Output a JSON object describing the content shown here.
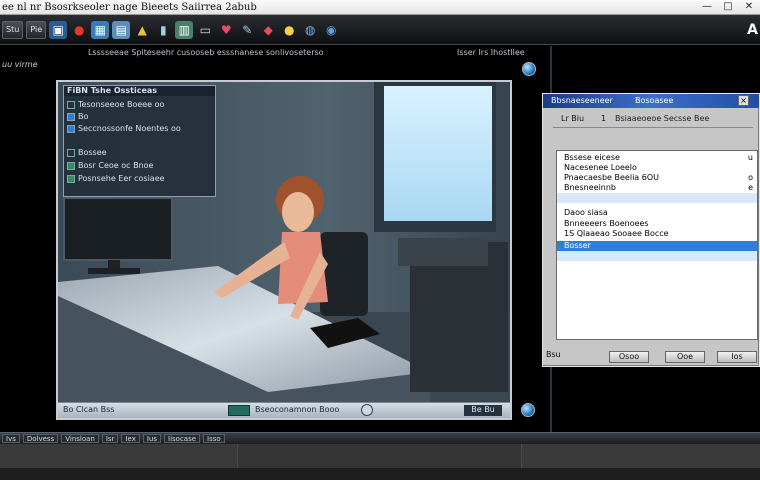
{
  "app": {
    "title": "ee  nl  nr  Bsosrkseoler  nage  Bieeets  Saiirrea  2abub",
    "controls": [
      "—",
      "□",
      "✕"
    ]
  },
  "toolbar": {
    "buttons": [
      "Stu",
      "Pie"
    ],
    "icons": [
      "picture-icon",
      "red-car-icon",
      "grid-icon",
      "photo-icon",
      "bottle-icon",
      "jar-icon",
      "cabinet-icon",
      "display-icon",
      "heart-icon",
      "feather-icon",
      "tag-icon",
      "flask-icon",
      "globe-icon",
      "bulb-icon"
    ],
    "right_glyph": "A"
  },
  "subbar": {
    "left": "Lsssseeae  Spiteseehr  cusooseb  esssnanese  sonlivoseterso",
    "right": "Isser  Irs  Ihostllee",
    "side_label": "uu virme"
  },
  "overlay": {
    "header": "FiBN  Tshe  Ossticeas",
    "rows": [
      "Tesonseeoe  Boeee  oo",
      "Bo",
      "Seccnossonfe  Noentes  oo",
      "Bossee",
      "Bosr  Ceoe  oc  Bnoe",
      "Posnsehe  Eer  cosiaee"
    ]
  },
  "viewport_status": {
    "left": "Bo  Clcan  Bss",
    "middle": "Bseoconamnon  Booo",
    "right": "Be  Bu"
  },
  "dialog": {
    "title": "Bbsnaeseeneer",
    "title_right": "Bosoasee",
    "tabs": [
      "Lr  Biu",
      "1"
    ],
    "caption": "Bsiaaeoeoe  Secsse  Bee",
    "items": [
      {
        "label": "Bssese  eicese",
        "value": "u"
      },
      {
        "label": "Nacesenee  Loeelo",
        "value": ""
      },
      {
        "label": "Pnaecaesbe  Beelia  6OU",
        "value": "o"
      },
      {
        "label": "Bnesneeinnb",
        "value": "e"
      },
      {
        "label": "",
        "value": ""
      },
      {
        "label": "Daoo  siasa",
        "value": ""
      },
      {
        "label": "Bnneeeers  Boenoees",
        "value": ""
      },
      {
        "label": "1S  Qlaaeao  Sooaee  Bocce",
        "value": ""
      },
      {
        "label": "Bosser",
        "value": ""
      },
      {
        "label": "",
        "value": ""
      }
    ],
    "foot": "Bsu",
    "ok": "Osoo",
    "cancel": "Ooe",
    "apply": "Ios"
  },
  "taskbar": {
    "items": [
      "Ivs",
      "Dolvess",
      "Vinsloan",
      "Isr",
      "Iex",
      "Ius",
      "Iisocase",
      "Isso"
    ]
  }
}
